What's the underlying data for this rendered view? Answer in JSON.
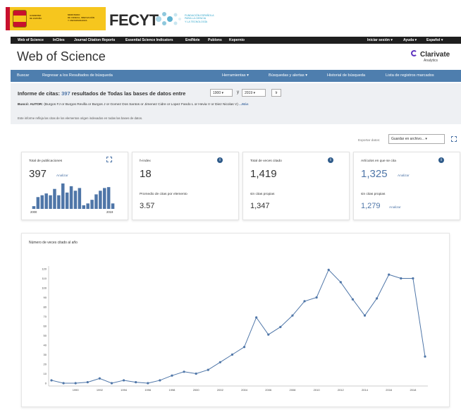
{
  "banner": {
    "gov_text": [
      "GOBIERNO",
      "DE ESPAÑA"
    ],
    "ministry_text": [
      "MINISTERIO",
      "DE CIENCIA, INNOVACIÓN",
      "Y UNIVERSIDADES"
    ],
    "fecyt": "FECYT",
    "fecyt_sub": [
      "FUNDACIÓN ESPAÑOLA",
      "PARA LA CIENCIA",
      "Y LA TECNOLOGÍA"
    ]
  },
  "topbar": {
    "items": [
      "Web of Science",
      "InCites",
      "Journal Citation Reports",
      "Essential Science Indicators",
      "EndNote",
      "Publons",
      "Kopernio"
    ],
    "right": [
      "Iniciar sesión ▾",
      "Ayuda ▾",
      "Español ▾"
    ]
  },
  "header": {
    "title": "Web of Science",
    "brand": "Clarivate",
    "brand_sub": "Analytics"
  },
  "nav": {
    "left": [
      "Buscar",
      "Regresar a los Resultados de búsqueda"
    ],
    "right": [
      "Herramientas ▾",
      "Búsquedas y alertas ▾",
      "Historial de búsqueda",
      "Lista de registros marcados"
    ]
  },
  "report": {
    "title_prefix": "Informe de citas:",
    "count": "397",
    "title_suffix": "resultados de Todas las bases de datos  entre",
    "from_year": "1900 ▾",
    "y_label": "y",
    "to_year": "2019 ▾",
    "go": "Ir",
    "search_label": "Buscó: AUTOR:",
    "search_query": "(Burgos FJ or Burgos Revilla or Burgos J or Gomez Dos Santos or Jimenez Cidre or Lopez Fando L or Hevia V or Diez Nicolas V)",
    "more": "...Más",
    "note": "Este informe refleja las citas de los elementos origen indexados en todas las bases de datos."
  },
  "export": {
    "label": "Exportar datos:",
    "value": "Guardar en archivo...  ▾"
  },
  "cards": {
    "publications": {
      "label": "Total de publicaciones",
      "value": "397",
      "link": "Analizar",
      "year_start": "2000",
      "year_end": "2019"
    },
    "hindex": {
      "label": "h-index",
      "value": "18",
      "avg_label": "Promedio de citas por elemento",
      "avg_value": "3.57"
    },
    "citations": {
      "label": "Total de veces citado",
      "value": "1,419",
      "self_label": "sin citas propias",
      "self_value": "1,347"
    },
    "citing": {
      "label": "Artículos en que se cita",
      "value": "1,325",
      "link": "Analizar",
      "self_label": "sin citas propias",
      "self_value": "1,279",
      "self_link": "Analizar"
    }
  },
  "chart_title": "Número de veces citado al año",
  "spark_data": {
    "type": "bar",
    "values": [
      3,
      13,
      15,
      17,
      15,
      22,
      15,
      28,
      18,
      25,
      20,
      23,
      4,
      6,
      10,
      16,
      20,
      23,
      24,
      6
    ]
  },
  "chart_data": {
    "type": "line",
    "title": "Número de veces citado al año",
    "x": [
      1988,
      1989,
      1990,
      1991,
      1992,
      1993,
      1994,
      1995,
      1996,
      1997,
      1998,
      1999,
      2000,
      2001,
      2002,
      2003,
      2004,
      2005,
      2006,
      2007,
      2008,
      2009,
      2010,
      2011,
      2012,
      2013,
      2014,
      2015,
      2016,
      2017,
      2018,
      2019
    ],
    "series": [
      {
        "values": [
          3,
          0,
          0,
          1,
          5,
          0,
          3,
          1,
          0,
          3,
          8,
          12,
          10,
          14,
          22,
          30,
          38,
          69,
          51,
          59,
          71,
          86,
          90,
          119,
          106,
          88,
          71,
          89,
          114,
          110,
          110,
          28
        ]
      }
    ],
    "xticks": [
      1990,
      1992,
      1994,
      1996,
      1998,
      2000,
      2002,
      2004,
      2006,
      2008,
      2010,
      2012,
      2014,
      2016,
      2018
    ],
    "yticks": [
      0,
      10,
      20,
      30,
      40,
      50,
      60,
      70,
      80,
      90,
      100,
      110,
      120
    ],
    "ylim": [
      0,
      120
    ],
    "grid": false,
    "color": "#4f76a8"
  },
  "colors": {
    "nav_blue": "#4e7eae",
    "link_blue": "#4f76a8",
    "topbar": "#1f1f1f",
    "banner_yellow": "#f6c61e"
  }
}
